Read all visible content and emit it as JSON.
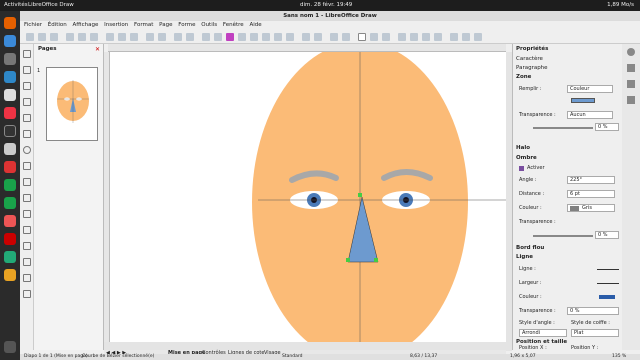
{
  "topbar": {
    "activities": "Activités",
    "app": "LibreOffice Draw",
    "clock": "dim. 28 févr. 19:49",
    "tray": "1,89 Mo/s"
  },
  "window": {
    "title": "Sans nom 1 - LibreOffice Draw"
  },
  "menu": [
    "Fichier",
    "Édition",
    "Affichage",
    "Insertion",
    "Format",
    "Page",
    "Forme",
    "Outils",
    "Fenêtre",
    "Aide"
  ],
  "pages": {
    "title": "Pages",
    "page1": "1"
  },
  "sidebar": {
    "title": "Propriétés",
    "caractere": "Caractère",
    "paragraphe": "Paragraphe",
    "zone": "Zone",
    "remplir_label": "Remplir :",
    "remplir_value": "Couleur",
    "transparence_label": "Transparence :",
    "transparence_value": "Aucun",
    "transparence_pct": "0 %",
    "halo": "Halo",
    "ombre": "Ombre",
    "activer": "Activer",
    "angle_label": "Angle :",
    "angle_value": "225°",
    "distance_label": "Distance :",
    "distance_value": "6 pt",
    "couleur_label": "Couleur :",
    "couleur_value": "Gris",
    "ombre_transp_label": "Transparence :",
    "ombre_transp_value": "0 %",
    "bord_flou": "Bord flou",
    "ligne": "Ligne",
    "ligne_label": "Ligne :",
    "largeur_label": "Largeur :",
    "ligne_couleur_label": "Couleur :",
    "ligne_transp_label": "Transparence :",
    "ligne_transp_value": "0 %",
    "style_angle_label": "Style d'angle :",
    "style_angle_value": "Arrondi",
    "style_coiffe_label": "Style de coiffe :",
    "style_coiffe_value": "Plat",
    "position_taille": "Position et taille",
    "position_x": "Position X :",
    "position_y": "Position Y :"
  },
  "tabs": [
    "Mise en page",
    "Contrôles",
    "Lignes de cote",
    "Visage"
  ],
  "status": {
    "slide": "Diapo 1 de 1 (Mise en page)",
    "selection": "Courbe de Bézier sélectionné(e)",
    "style": "Standard",
    "pos": "8,63 / 13,37",
    "size": "1,96 x 5,07",
    "zoom": "135 %"
  },
  "colors": {
    "skin": "#fbbb77",
    "nose": "#6d9acf",
    "eyebrow": "#a8a8a8",
    "iris": "#4a7ab8",
    "accent": "#3a7bd5"
  }
}
